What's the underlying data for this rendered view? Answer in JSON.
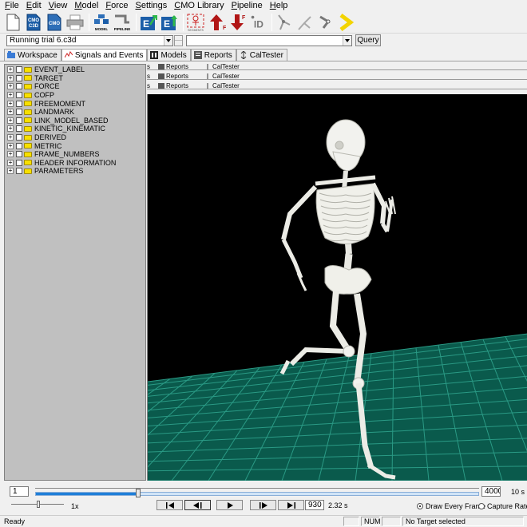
{
  "menu": [
    "File",
    "Edit",
    "View",
    "Model",
    "Force",
    "Settings",
    "CMO Library",
    "Pipeline",
    "Help"
  ],
  "toolbar": {
    "icons": [
      "new-file-icon",
      "cmo-c3d-icon",
      "cmo-icon",
      "print-icon",
      "model-icon",
      "pipeline-icon",
      "export-e-icon",
      "export-e-up-icon",
      "body-segment-icon",
      "force-up-icon",
      "force-down-icon",
      "id-icon",
      "skeleton-link-icon",
      "skeleton-link2-icon",
      "link-chain-icon",
      "yellow-chevron-icon"
    ],
    "labels": {
      "cmo_top": "CMO",
      "cmo_bot": "C3D",
      "cmo2": "CMO",
      "model": "MODEL",
      "pipeline": "PIPELINE",
      "id": "ID"
    }
  },
  "filebar": {
    "file_value": "Running trial 6.c3d",
    "second_value": "",
    "query_label": "Query"
  },
  "tabs": [
    {
      "label": "Workspace",
      "icon": "workspace-icon",
      "active": false
    },
    {
      "label": "Signals and Events",
      "icon": "signals-icon",
      "active": true
    },
    {
      "label": "Models",
      "icon": "models-icon",
      "active": false
    },
    {
      "label": "Reports",
      "icon": "reports-icon",
      "active": false
    },
    {
      "label": "CalTester",
      "icon": "caltester-icon",
      "active": false
    }
  ],
  "subtab_rows": [
    {
      "left": "s",
      "reports": "Reports",
      "caltester": "CalTester"
    },
    {
      "left": "s",
      "reports": "Reports",
      "caltester": "CalTester"
    },
    {
      "left": "s",
      "reports": "Reports",
      "caltester": "CalTester"
    }
  ],
  "tree": [
    "EVENT_LABEL",
    "TARGET",
    "FORCE",
    "COFP",
    "FREEMOMENT",
    "LANDMARK",
    "LINK_MODEL_BASED",
    "KINETIC_KINEMATIC",
    "DERIVED",
    "METRIC",
    "FRAME_NUMBERS",
    "HEADER INFORMATION",
    "PARAMETERS"
  ],
  "tree_expander": "+",
  "timeline": {
    "start_frame": "1",
    "end_frame": "4000",
    "time_total": "10 s",
    "current_frame": "930",
    "current_time": "2.32 s",
    "speed": "1x",
    "progress": 0.2325,
    "draw_every_frame": "Draw Every Frame",
    "capture_rate": "Capture Rate"
  },
  "status": {
    "ready": "Ready",
    "num": "NUM",
    "target": "No Target selected"
  },
  "colors": {
    "floor": "#0a5a4c",
    "grid": "#2a9a85",
    "bone": "#f2f2ee",
    "track": "#1f7fd8"
  }
}
